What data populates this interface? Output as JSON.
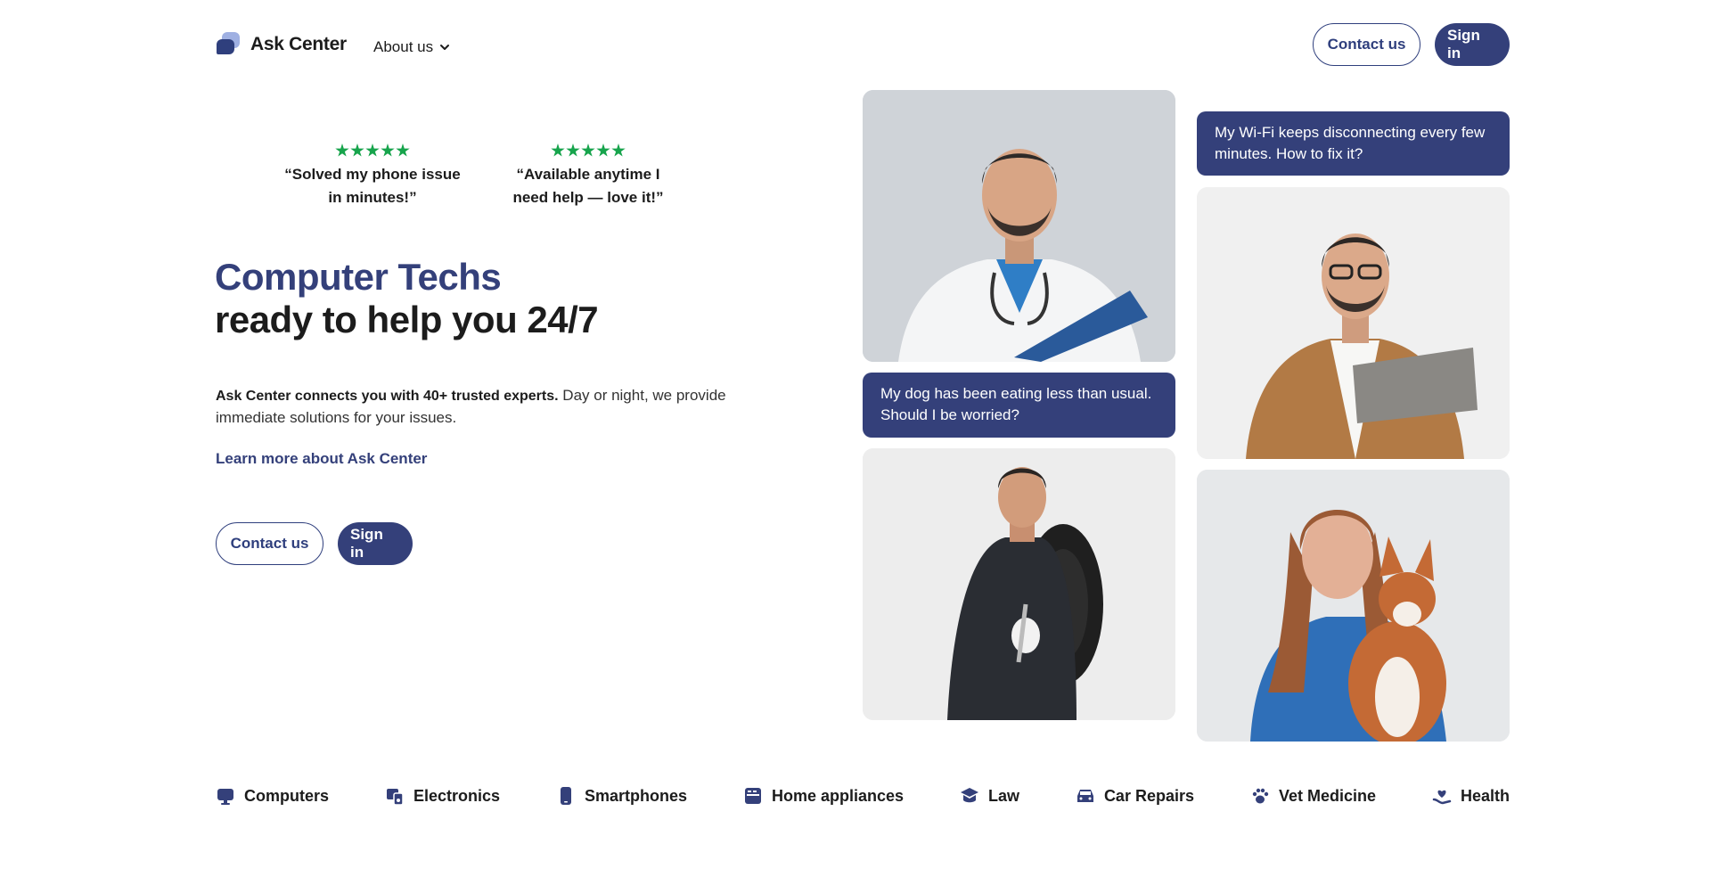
{
  "header": {
    "logo_text": "Ask Center",
    "about_label": "About us",
    "contact_label": "Contact us",
    "signin_label": "Sign in"
  },
  "testimonials": [
    {
      "stars": 5,
      "quote": "“Solved my phone issue in minutes!”"
    },
    {
      "stars": 5,
      "quote": "“Available anytime I need help — love it!”"
    }
  ],
  "hero": {
    "title_line1": "Computer Techs",
    "title_line2": "ready to help you 24/7",
    "desc_bold": "Ask Center connects you with 40+ trusted experts.",
    "desc_rest": " Day or night, we provide immediate solutions for your issues.",
    "learn_more": "Learn more about Ask Center",
    "contact_label": "Contact us",
    "signin_label": "Sign in"
  },
  "bubbles": {
    "wifi": "My Wi-Fi keeps disconnecting every few minutes. How to fix it?",
    "dog": "My dog has been eating less than usual. Should I be worried?"
  },
  "categories": [
    {
      "label": "Computers",
      "icon": "monitor-icon"
    },
    {
      "label": "Electronics",
      "icon": "devices-icon"
    },
    {
      "label": "Smartphones",
      "icon": "smartphone-icon"
    },
    {
      "label": "Home appliances",
      "icon": "appliance-icon"
    },
    {
      "label": "Law",
      "icon": "law-icon"
    },
    {
      "label": "Car Repairs",
      "icon": "car-icon"
    },
    {
      "label": "Vet Medicine",
      "icon": "paw-icon"
    },
    {
      "label": "Health",
      "icon": "health-icon"
    }
  ],
  "colors": {
    "brand": "#34407a",
    "star": "#17a44c",
    "logo_light": "#9fb0e2"
  }
}
